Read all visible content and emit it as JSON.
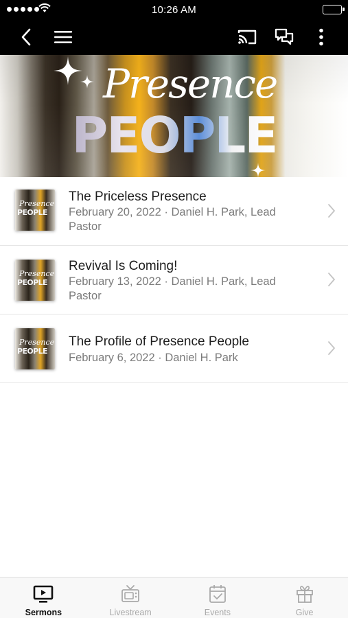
{
  "status_bar": {
    "time": "10:26 AM"
  },
  "nav": {
    "back_icon": "chevron-left-icon",
    "menu_icon": "hamburger-menu-icon",
    "cast_icon": "cast-icon",
    "chat_icon": "chat-icon",
    "more_icon": "more-vertical-icon"
  },
  "banner": {
    "script_text": "Presence",
    "word_text": "PEOPLE"
  },
  "thumbnail": {
    "script_text": "Presence",
    "word_text": "PEOPLE"
  },
  "sermons": [
    {
      "title": "The Priceless Presence",
      "meta": "February 20, 2022 · Daniel H. Park, Lead Pastor"
    },
    {
      "title": "Revival Is Coming!",
      "meta": "February 13, 2022 · Daniel H. Park, Lead Pastor"
    },
    {
      "title": "The Profile of Presence People",
      "meta": "February 6, 2022 · Daniel H. Park"
    }
  ],
  "tabs": [
    {
      "label": "Sermons",
      "icon": "tv-play-icon",
      "active": true
    },
    {
      "label": "Livestream",
      "icon": "retro-tv-icon",
      "active": false
    },
    {
      "label": "Events",
      "icon": "calendar-check-icon",
      "active": false
    },
    {
      "label": "Give",
      "icon": "gift-icon",
      "active": false
    }
  ]
}
